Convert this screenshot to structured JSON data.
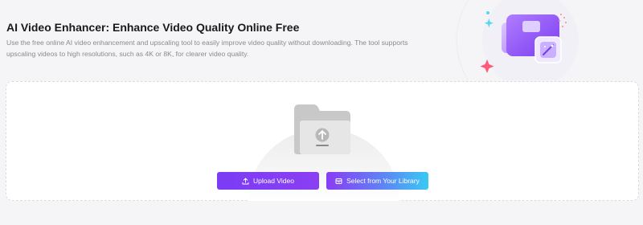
{
  "header": {
    "title": "AI Video Enhancer: Enhance Video Quality Online Free",
    "description": "Use the free online AI video enhancement and upscaling tool to easily improve video quality without downloading. The tool supports upscaling videos to high resolutions, such as 4K or 8K, for clearer video quality."
  },
  "hero": {
    "icon": "video-enhance-illustration"
  },
  "upload": {
    "folder_icon": "upload-folder-icon",
    "upload_button_label": "Upload Video",
    "upload_button_icon": "upload-icon",
    "library_button_label": "Select from Your Library",
    "library_button_icon": "library-box-icon"
  },
  "colors": {
    "accent_purple": "#7b3cf5",
    "accent_cyan": "#38c9f3",
    "title": "#1a1a1a",
    "description": "#8a8a8a"
  }
}
